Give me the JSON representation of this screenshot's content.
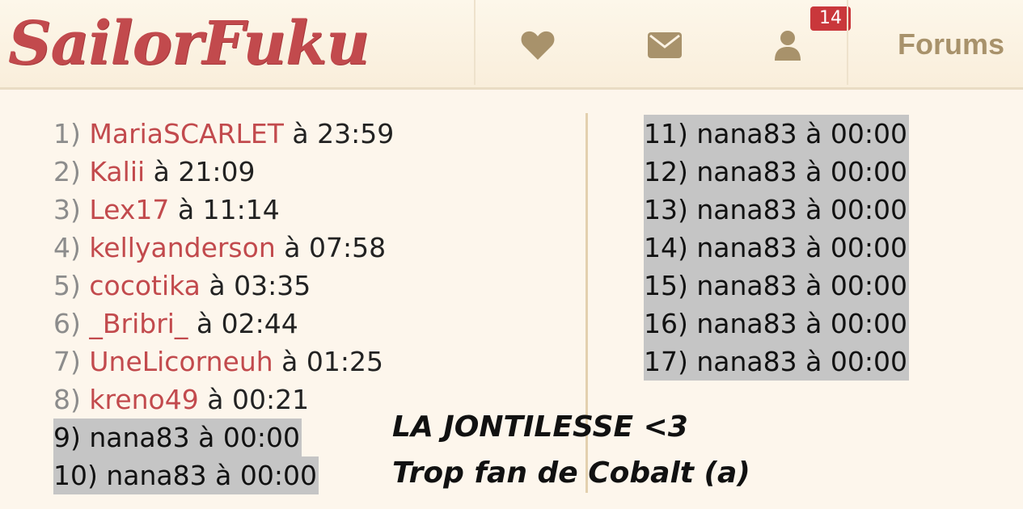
{
  "header": {
    "logo_text": "SailorFuku",
    "nav": {
      "favorites_icon": "heart-icon",
      "messages_icon": "envelope-icon",
      "profile_icon": "user-icon",
      "notification_count": "14",
      "forums_label": "Forums"
    },
    "colors": {
      "logo": "#c24a4d",
      "nav_icons": "#a8926b",
      "badge": "#c9373b"
    }
  },
  "list": {
    "at": "à",
    "left_items": [
      {
        "rank": "1)",
        "user": "MariaSCARLET",
        "time": "23:59",
        "highlighted": false
      },
      {
        "rank": "2)",
        "user": "Kalii",
        "time": "21:09",
        "highlighted": false
      },
      {
        "rank": "3)",
        "user": "Lex17",
        "time": "11:14",
        "highlighted": false
      },
      {
        "rank": "4)",
        "user": "kellyanderson",
        "time": "07:58",
        "highlighted": false
      },
      {
        "rank": "5)",
        "user": "cocotika",
        "time": "03:35",
        "highlighted": false
      },
      {
        "rank": "6)",
        "user": "_Bribri_",
        "time": "02:44",
        "highlighted": false
      },
      {
        "rank": "7)",
        "user": "UneLicorneuh",
        "time": "01:25",
        "highlighted": false
      },
      {
        "rank": "8)",
        "user": "kreno49",
        "time": "00:21",
        "highlighted": false
      },
      {
        "rank": "9)",
        "user": "nana83",
        "time": "00:00",
        "highlighted": true
      },
      {
        "rank": "10)",
        "user": "nana83",
        "time": "00:00",
        "highlighted": true
      }
    ],
    "right_items": [
      {
        "rank": "11)",
        "user": "nana83",
        "time": "00:00",
        "highlighted": true
      },
      {
        "rank": "12)",
        "user": "nana83",
        "time": "00:00",
        "highlighted": true
      },
      {
        "rank": "13)",
        "user": "nana83",
        "time": "00:00",
        "highlighted": true
      },
      {
        "rank": "14)",
        "user": "nana83",
        "time": "00:00",
        "highlighted": true
      },
      {
        "rank": "15)",
        "user": "nana83",
        "time": "00:00",
        "highlighted": true
      },
      {
        "rank": "16)",
        "user": "nana83",
        "time": "00:00",
        "highlighted": true
      },
      {
        "rank": "17)",
        "user": "nana83",
        "time": "00:00",
        "highlighted": true
      }
    ]
  },
  "captions": {
    "line1": "LA JONTILESSE <3",
    "line2": "Trop fan de Cobalt (a)"
  }
}
